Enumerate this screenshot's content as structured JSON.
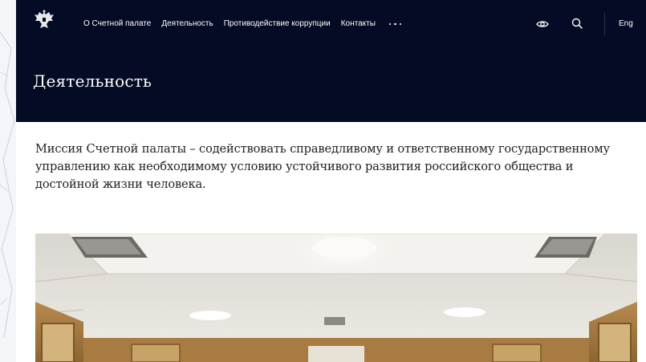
{
  "header": {
    "logo_icon": "double-headed-eagle-emblem",
    "nav": [
      {
        "label": "О Счетной палате"
      },
      {
        "label": "Деятельность"
      },
      {
        "label": "Противодействие коррупции"
      },
      {
        "label": "Контакты"
      }
    ],
    "more_icon": "more-dots-icon",
    "accessibility_icon": "eye-icon",
    "search_icon": "search-icon",
    "language_label": "Eng",
    "background_color": "#040b24"
  },
  "page": {
    "title": "Деятельность",
    "mission_text": "Миссия Счетной палаты – содействовать справедливому и ответственному государственному управлению как необходимому условию устойчивого развития российского общества и достойной жизни человека."
  },
  "hero_image": {
    "description_icon": "hall-ceiling-photo"
  }
}
